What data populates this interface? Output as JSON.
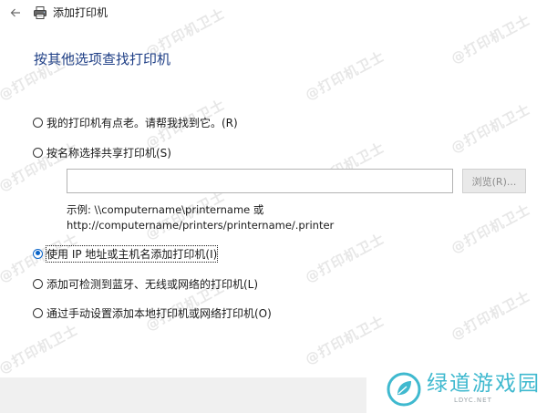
{
  "window": {
    "title": "添加打印机"
  },
  "heading": "按其他选项查找打印机",
  "options": [
    {
      "label": "我的打印机有点老。请帮我找到它。(R)",
      "checked": false
    },
    {
      "label": "按名称选择共享打印机(S)",
      "checked": false
    },
    {
      "label": "使用 IP 地址或主机名添加打印机(I)",
      "checked": true
    },
    {
      "label": "添加可检测到蓝牙、无线或网络的打印机(L)",
      "checked": false
    },
    {
      "label": "通过手动设置添加本地打印机或网络打印机(O)",
      "checked": false
    }
  ],
  "shared_printer": {
    "value": "",
    "browse_label": "浏览(R)...",
    "example_line1": "示例: \\\\computername\\printername 或",
    "example_line2": "http://computername/printers/printername/.printer"
  },
  "watermark": "@打印机卫士",
  "logo": {
    "name": "绿道游戏园",
    "domain": "LDYC.NET"
  },
  "colors": {
    "heading": "#1f3f86",
    "radio_selected": "#0a64c8",
    "logo": "#3fb9cf"
  }
}
